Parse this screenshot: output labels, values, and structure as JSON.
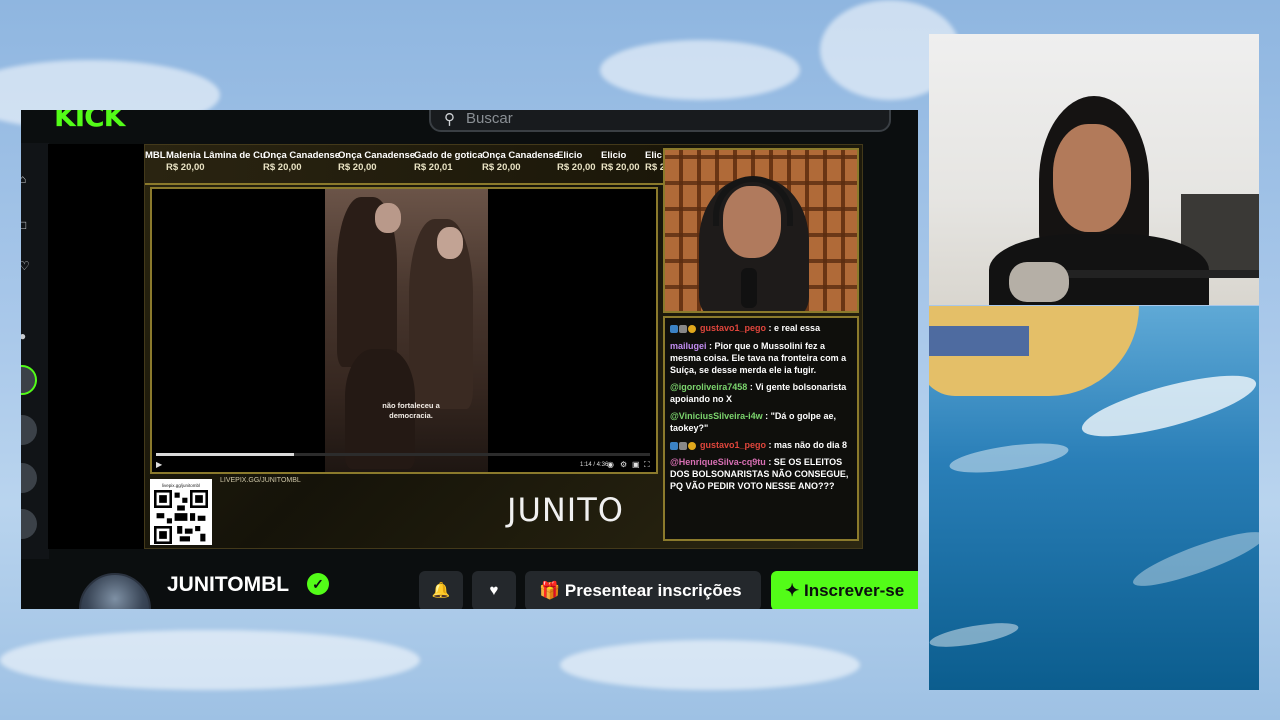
{
  "kick": {
    "logo": "KICK",
    "search_placeholder": "Buscar"
  },
  "ticker": [
    {
      "name": "MBL",
      "price": ""
    },
    {
      "name": "Malenia Lâmina de Cu",
      "price": "R$ 20,00"
    },
    {
      "name": "Onça Canadense",
      "price": "R$ 20,00"
    },
    {
      "name": "Onça Canadense",
      "price": "R$ 20,00"
    },
    {
      "name": "Gado de gotica",
      "price": "R$ 20,01"
    },
    {
      "name": "Onça Canadense",
      "price": "R$ 20,00"
    },
    {
      "name": "Elicio",
      "price": "R$ 20,00"
    },
    {
      "name": "Elicio",
      "price": "R$ 20,00"
    },
    {
      "name": "Elic",
      "price": "R$ 2"
    }
  ],
  "video": {
    "caption": "não fortaleceu a democracia.",
    "time": "1:14 / 4:36",
    "progress": 0.28
  },
  "overlay": {
    "qr_label": "livepix.gg/junitombl",
    "livepix": "LIVEPIX.GG/JUNITOMBL",
    "brand": "JUNITO"
  },
  "chat": [
    {
      "user": "gustavo1_pego",
      "color": "#e0463c",
      "badges": true,
      "text": ": e real essa"
    },
    {
      "user": "mailugei",
      "color": "#c18cf0",
      "badges": false,
      "text": ": Pior que o Mussolini fez a mesma coisa. Ele tava na fronteira com a Suíça, se desse merda ele ia fugir."
    },
    {
      "user": "@igoroliveira7458",
      "color": "#7bd46d",
      "badges": false,
      "text": ": Vi gente bolsonarista apoiando no X"
    },
    {
      "user": "@ViniciusSilveira-i4w",
      "color": "#7bd46d",
      "badges": false,
      "text": ": \"Dá o golpe ae, taokey?\""
    },
    {
      "user": "gustavo1_pego",
      "color": "#e0463c",
      "badges": true,
      "text": ": mas não do dia 8"
    },
    {
      "user": "@HenriqueSilva-cq9tu",
      "color": "#d76fb3",
      "badges": false,
      "text": ": SE OS ELEITOS DOS BOLSONARISTAS NÃO CONSEGUE, PQ VÃO PEDIR VOTO NESSE ANO???"
    }
  ],
  "channel": {
    "name": "JUNITOMBL",
    "gift_label": "Presentear inscrições",
    "subscribe_label": "Inscrever-se"
  },
  "colors": {
    "kick_green": "#53fc18",
    "overlay_gold": "#8b7a2c"
  }
}
